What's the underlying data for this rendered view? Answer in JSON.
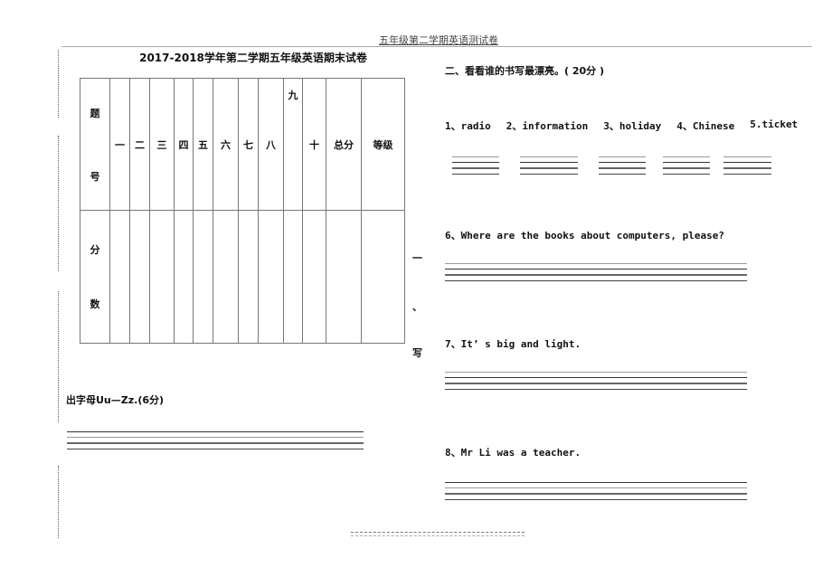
{
  "running_header": "五年级第二学期英语测试卷",
  "exam_title": "2017-2018学年第二学期五年级英语期末试卷",
  "score_table": {
    "row_header_top": [
      "题",
      "号"
    ],
    "row_header_bottom": [
      "分",
      "数"
    ],
    "columns": [
      "一",
      "二",
      "三",
      "四",
      "五",
      "六",
      "七",
      "八",
      "九",
      "十",
      "总分",
      "等级"
    ]
  },
  "section1": {
    "vertical_chars": [
      "一",
      "、",
      "写"
    ],
    "title_rest": "出字母Uu—Zz.(6分)"
  },
  "section2": {
    "title": "二、看看谁的书写最漂亮。( 20分 )",
    "words": [
      "1、radio",
      "2、information",
      "3、holiday",
      "4、Chinese",
      "5.ticket"
    ],
    "sentences": [
      "6、Where are the books about computers, please?",
      "7、It’ s big and light.",
      "8、Mr Li was a teacher."
    ]
  }
}
